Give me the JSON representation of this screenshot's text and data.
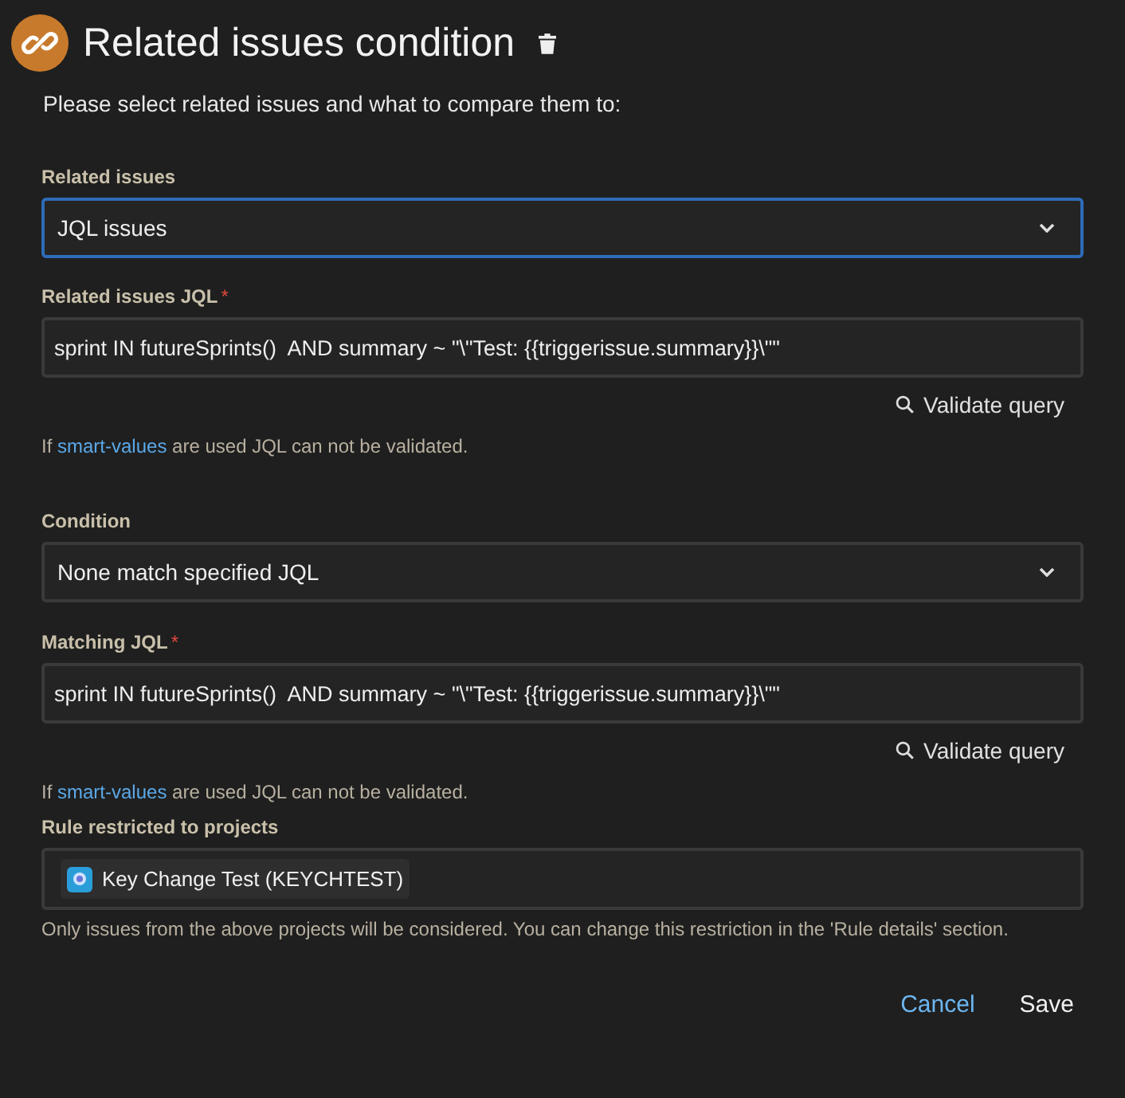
{
  "title": "Related issues condition",
  "subtitle": "Please select related issues and what to compare them to:",
  "fields": [
    {
      "kind": "select",
      "label": "Related issues",
      "value": "JQL issues",
      "focused": true
    },
    {
      "kind": "jql",
      "label": "Related issues JQL",
      "required_mark": "*",
      "value": "sprint IN futureSprints()  AND summary ~ \"\\\"Test: {{triggerissue.summary}}\\\"\"",
      "validate": "Validate query",
      "hint_before": "If ",
      "hint_link": "smart-values",
      "hint_after": " are used JQL can not be validated."
    },
    {
      "kind": "select",
      "label": "Condition",
      "value": "None match specified JQL",
      "focused": false
    },
    {
      "kind": "jql",
      "label": "Matching JQL",
      "required_mark": "*",
      "value": "sprint IN futureSprints()  AND summary ~ \"\\\"Test: {{triggerissue.summary}}\\\"\"",
      "validate": "Validate query",
      "hint_before": "If ",
      "hint_link": "smart-values",
      "hint_after": " are used JQL can not be validated."
    },
    {
      "kind": "projects",
      "label": "Rule restricted to projects",
      "projects": [
        "Key Change Test (KEYCHTEST)"
      ],
      "note": "Only issues from the above projects will be considered. You can change this restriction in the 'Rule details' section."
    }
  ],
  "buttons": [
    {
      "label": "Cancel"
    },
    {
      "label": "Save"
    }
  ]
}
